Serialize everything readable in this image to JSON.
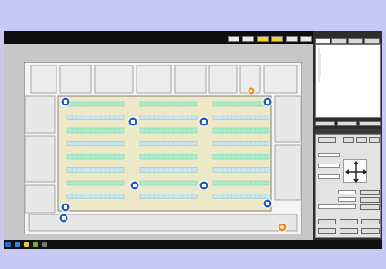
{
  "app": {
    "title": "",
    "toolbar_buttons": [
      {
        "label": "",
        "active": false
      },
      {
        "label": "",
        "active": false
      },
      {
        "label": "",
        "active": true
      },
      {
        "label": "",
        "active": true
      },
      {
        "label": "",
        "active": false
      },
      {
        "label": "",
        "active": false
      }
    ]
  },
  "floor_plan": {
    "row_count": 8,
    "seat_columns": 3,
    "camera_icons": 10,
    "colors": {
      "floor": "#ece8c8",
      "seats_green": "#a8f0c8",
      "seats_blue": "#c8e4f6",
      "camera": "#1f5ebf",
      "alert": "#f08a1c"
    }
  },
  "side_panel": {
    "tabs": [
      "",
      "",
      "",
      ""
    ],
    "tree": [
      "",
      "",
      "",
      "",
      "",
      "",
      "",
      "",
      "",
      ""
    ],
    "buttons": [
      "",
      "",
      ""
    ],
    "control_header": "",
    "control_labels": [
      "",
      "",
      "",
      "",
      "",
      "",
      "",
      "",
      "",
      "",
      "",
      ""
    ]
  },
  "taskbar": {
    "tray_text": "",
    "clock_time": "",
    "clock_date": ""
  },
  "colors": {
    "background": "#c9c8f4",
    "titlebar": "#0e0e0e",
    "panel": "#2c2c2c",
    "highlight": "#f2d23a"
  }
}
